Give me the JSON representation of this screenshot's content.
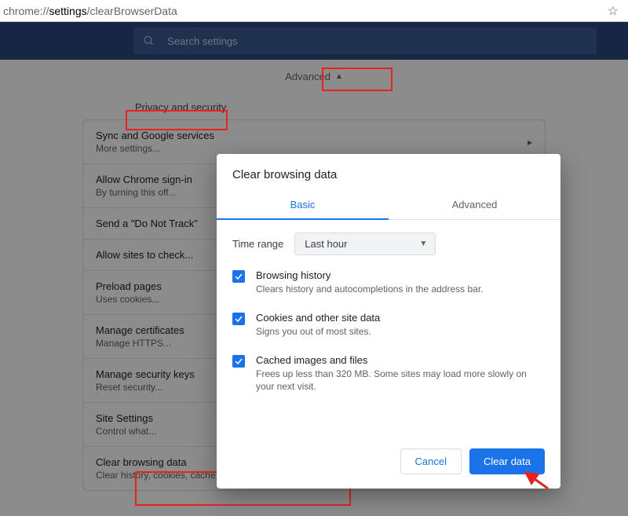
{
  "address": {
    "scheme_host": "chrome://",
    "bold": "settings",
    "rest": "/clearBrowserData"
  },
  "search": {
    "placeholder": "Search settings"
  },
  "advanced_label": "Advanced",
  "section_label": "Privacy and security",
  "rows": [
    {
      "title": "Sync and Google services",
      "sub": "More settings...",
      "control": "arrow"
    },
    {
      "title": "Allow Chrome sign-in",
      "sub": "By turning this off...",
      "control": "toggle_on"
    },
    {
      "title": "Send a \"Do Not Track\"",
      "sub": "",
      "control": "toggle_off"
    },
    {
      "title": "Allow sites to check...",
      "sub": "",
      "control": "toggle_on"
    },
    {
      "title": "Preload pages",
      "sub": "Uses cookies...",
      "control": "toggle_on"
    },
    {
      "title": "Manage certificates",
      "sub": "Manage HTTPS...",
      "control": "ext"
    },
    {
      "title": "Manage security keys",
      "sub": "Reset security...",
      "control": "arrow"
    },
    {
      "title": "Site Settings",
      "sub": "Control what...",
      "control": "arrow"
    },
    {
      "title": "Clear browsing data",
      "sub": "Clear history, cookies, cache, and more",
      "control": "arrow"
    }
  ],
  "dialog": {
    "title": "Clear browsing data",
    "tabs": {
      "basic": "Basic",
      "advanced": "Advanced"
    },
    "time_range_label": "Time range",
    "time_range_value": "Last hour",
    "options": [
      {
        "title": "Browsing history",
        "sub": "Clears history and autocompletions in the address bar.",
        "checked": true
      },
      {
        "title": "Cookies and other site data",
        "sub": "Signs you out of most sites.",
        "checked": true
      },
      {
        "title": "Cached images and files",
        "sub": "Frees up less than 320 MB. Some sites may load more slowly on your next visit.",
        "checked": true
      }
    ],
    "cancel": "Cancel",
    "clear": "Clear data"
  }
}
